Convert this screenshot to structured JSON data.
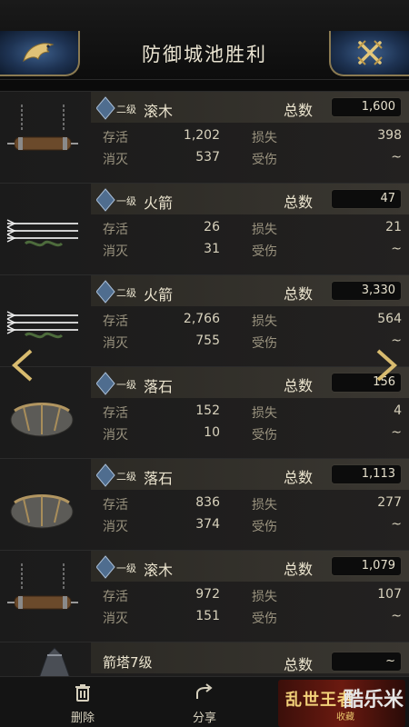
{
  "header": {
    "title": "防御城池胜利"
  },
  "labels": {
    "total": "总数",
    "survive": "存活",
    "destroy": "消灭",
    "loss": "损失",
    "injured": "受伤"
  },
  "units": [
    {
      "name": "滚木",
      "level": "二级",
      "total": "1,600",
      "survive": "1,202",
      "destroy": "537",
      "loss": "398",
      "injured": "~"
    },
    {
      "name": "火箭",
      "level": "一级",
      "total": "47",
      "survive": "26",
      "destroy": "31",
      "loss": "21",
      "injured": "~"
    },
    {
      "name": "火箭",
      "level": "二级",
      "total": "3,330",
      "survive": "2,766",
      "destroy": "755",
      "loss": "564",
      "injured": "~"
    },
    {
      "name": "落石",
      "level": "一级",
      "total": "156",
      "survive": "152",
      "destroy": "10",
      "loss": "4",
      "injured": "~"
    },
    {
      "name": "落石",
      "level": "二级",
      "total": "1,113",
      "survive": "836",
      "destroy": "374",
      "loss": "277",
      "injured": "~"
    },
    {
      "name": "滚木",
      "level": "一级",
      "total": "1,079",
      "survive": "972",
      "destroy": "151",
      "loss": "107",
      "injured": "~"
    }
  ],
  "last_unit": {
    "name": "箭塔7级",
    "total": "~"
  },
  "toolbar": {
    "delete": "删除",
    "share": "分享"
  },
  "promo": {
    "title": "乱世王者",
    "sub": "收藏",
    "logo": "酷乐米"
  }
}
